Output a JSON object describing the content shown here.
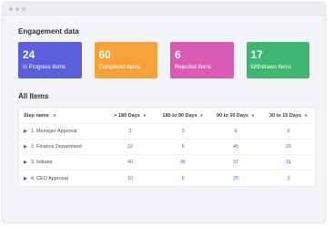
{
  "window": {
    "controls": [
      "dot",
      "dot",
      "dot"
    ]
  },
  "engagement": {
    "title": "Engagement data",
    "cards": [
      {
        "count": "24",
        "label": "In Progress Items",
        "color": "#5b5fdc"
      },
      {
        "count": "60",
        "label": "Completed Items",
        "color": "#f6a13a"
      },
      {
        "count": "6",
        "label": "Rejected Items",
        "color": "#d95bb4"
      },
      {
        "count": "17",
        "label": "Withdrawn Items",
        "color": "#3fb672"
      }
    ]
  },
  "all_items": {
    "title": "All Items",
    "columns": [
      "Step name",
      "> 180 Days",
      "180 to 90 Days",
      "90 to 30 Days",
      "30 to 15 Days"
    ],
    "rows": [
      {
        "name": "1.  Manager Approval",
        "values": [
          "3",
          "3",
          "6",
          "6"
        ]
      },
      {
        "name": "2.  Finance Department",
        "values": [
          "32",
          "6",
          "45",
          "20"
        ]
      },
      {
        "name": "3.  Initiator",
        "values": [
          "40",
          "45",
          "37",
          "31"
        ]
      },
      {
        "name": "4.  CEO Approval",
        "values": [
          "10",
          "9",
          "25",
          "3"
        ]
      }
    ]
  }
}
